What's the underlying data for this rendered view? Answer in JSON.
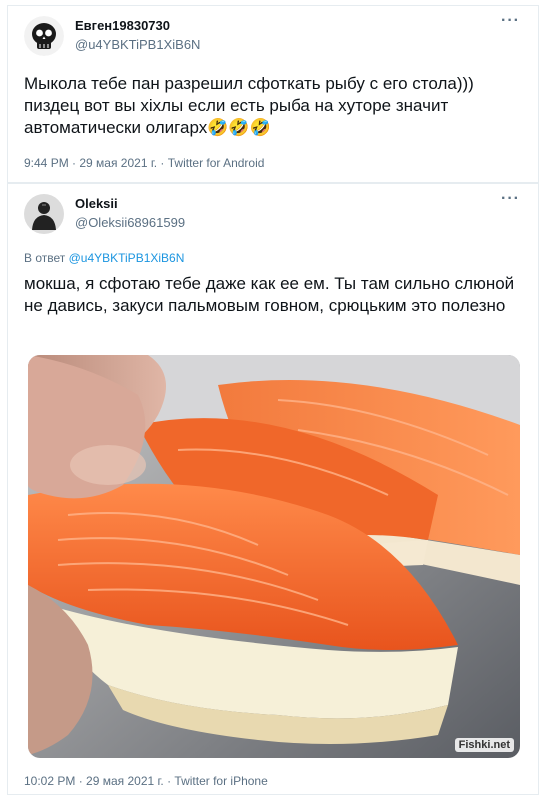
{
  "tweet1": {
    "author_name": "Евген19830730",
    "author_handle": "@u4YBKTiPB1XiB6N",
    "text": "Мыкола тебе пан разрешил сфоткать рыбу с его стола))) пиздец вот вы хіхлы если есть рыба на хуторе значит автоматически олигарх🤣🤣🤣",
    "meta": "9:44 PM · 29 мая 2021 г. · Twitter for Android",
    "avatar_icon": "skull-avatar-icon",
    "more_icon": "more-icon"
  },
  "tweet2": {
    "author_name": "Oleksii",
    "author_handle": "@Oleksii68961599",
    "reply_prefix": "В ответ ",
    "reply_to": "@u4YBKTiPB1XiB6N",
    "text": "мокша, я сфотаю тебе даже как ее ем. Ты там сильно слюной не давись, закуси пальмовым говном, срюцьким это полезно",
    "meta": "10:02 PM · 29 мая 2021 г. · Twitter for iPhone",
    "avatar_icon": "dark-figure-avatar-icon",
    "photo_icon": "salmon-sandwich-photo",
    "more_icon": "more-icon"
  },
  "watermark": "Fishki.net",
  "colors": {
    "link": "#1b95e0",
    "muted": "#5b7083",
    "border": "#e6ecf0"
  }
}
